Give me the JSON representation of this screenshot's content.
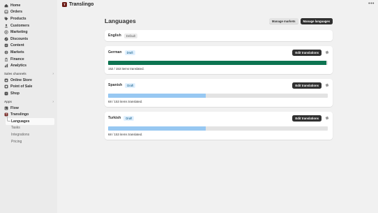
{
  "app": {
    "name": "Translingo",
    "logo_letter": "T"
  },
  "sidebar": {
    "main_items": [
      {
        "label": "Home",
        "icon": "home-icon"
      },
      {
        "label": "Orders",
        "icon": "orders-icon"
      },
      {
        "label": "Products",
        "icon": "tag-icon"
      },
      {
        "label": "Customers",
        "icon": "person-icon"
      },
      {
        "label": "Marketing",
        "icon": "target-icon"
      },
      {
        "label": "Discounts",
        "icon": "discount-icon"
      },
      {
        "label": "Content",
        "icon": "content-icon"
      },
      {
        "label": "Markets",
        "icon": "globe-icon"
      },
      {
        "label": "Finance",
        "icon": "bank-icon"
      },
      {
        "label": "Analytics",
        "icon": "chart-icon"
      }
    ],
    "sales_channels": {
      "label": "Sales channels",
      "items": [
        {
          "label": "Online Store",
          "icon": "store-icon"
        },
        {
          "label": "Point of Sale",
          "icon": "pos-icon"
        },
        {
          "label": "Shop",
          "icon": "shop-bag-icon"
        }
      ]
    },
    "apps": {
      "label": "Apps",
      "items": [
        {
          "label": "Flow",
          "icon": "flow-icon"
        },
        {
          "label": "Translingo",
          "icon": "translingo-icon"
        }
      ],
      "sub_items": [
        {
          "label": "Languages"
        },
        {
          "label": "Tasks"
        },
        {
          "label": "Integrations"
        },
        {
          "label": "Pricing"
        }
      ]
    }
  },
  "page": {
    "title": "Languages",
    "manage_markets": "Manage markets",
    "manage_languages": "Manage languages"
  },
  "default_language": {
    "name": "English",
    "badge": "Default"
  },
  "languages": [
    {
      "name": "German",
      "badge": "Draft",
      "button": "Edit translations",
      "progress_text": "152 / 153 items translated.",
      "translated": 152,
      "total": 153,
      "color": "#0d7451"
    },
    {
      "name": "Spanish",
      "badge": "Draft",
      "button": "Edit translations",
      "progress_text": "68 / 153 items translated.",
      "translated": 68,
      "total": 153,
      "color": "#97c8f2"
    },
    {
      "name": "Turkish",
      "badge": "Draft",
      "button": "Edit translations",
      "progress_text": "68 / 153 items translated.",
      "translated": 68,
      "total": 153,
      "color": "#97c8f2"
    }
  ]
}
